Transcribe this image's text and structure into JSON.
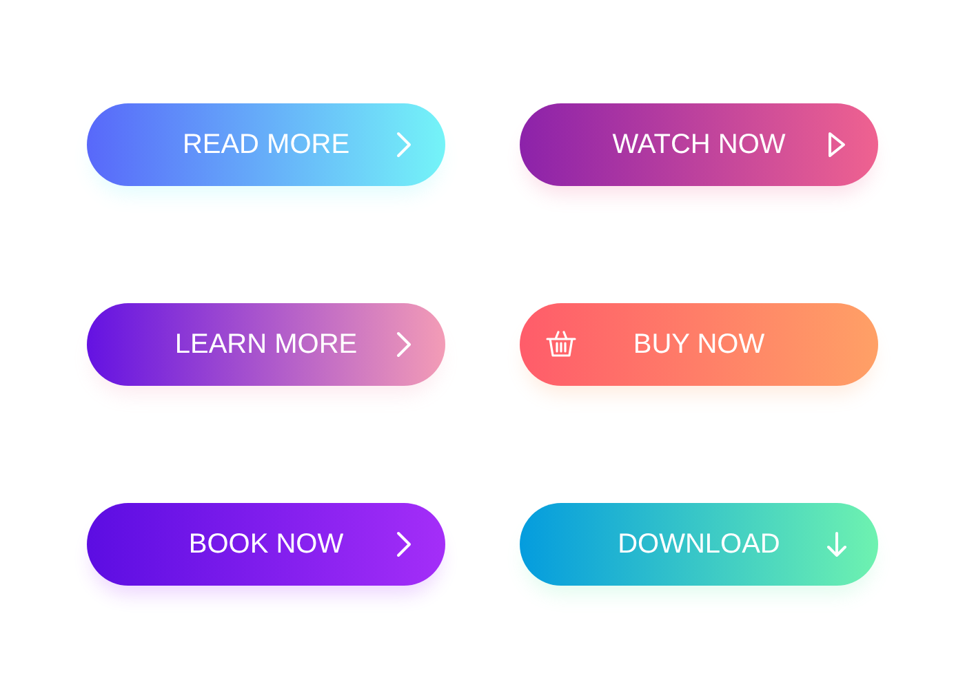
{
  "buttons": [
    {
      "label": "READ MORE",
      "kind": "chevron",
      "color": "#5868fa"
    },
    {
      "label": "WATCH NOW",
      "kind": "play",
      "color": "#8c22aa"
    },
    {
      "label": "LEARN MORE",
      "kind": "chevron",
      "color": "#6412e2"
    },
    {
      "label": "BUY NOW",
      "kind": "basket",
      "color": "#ff5c6a"
    },
    {
      "label": "BOOK NOW",
      "kind": "chevron",
      "color": "#5c0de2"
    },
    {
      "label": "DOWNLOAD",
      "kind": "arrow-down",
      "color": "#049cde"
    }
  ]
}
